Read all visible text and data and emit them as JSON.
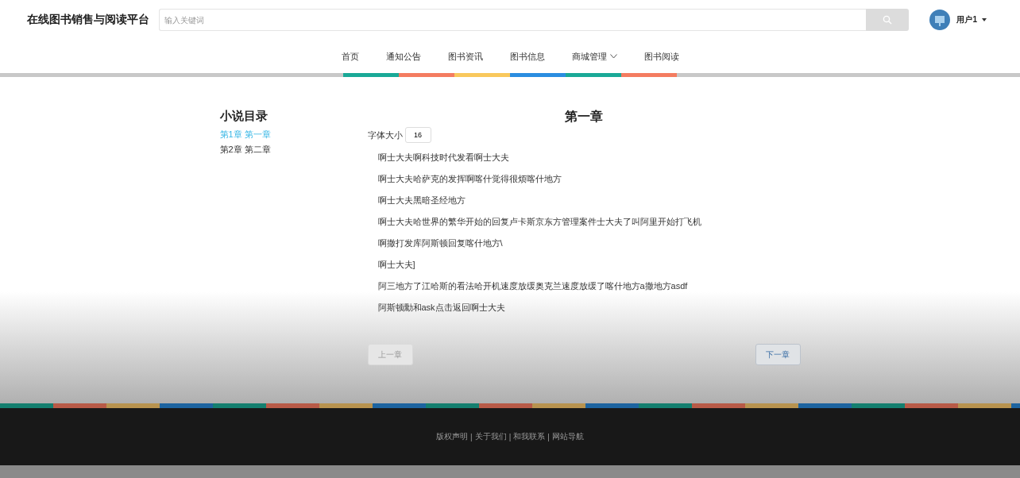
{
  "header": {
    "site_title": "在线图书销售与阅读平台",
    "search": {
      "placeholder": "输入关键词"
    },
    "user": {
      "name": "用户1"
    }
  },
  "nav": [
    {
      "label": "首页",
      "selected": false,
      "dropdown": false
    },
    {
      "label": "通知公告",
      "selected": false,
      "dropdown": false
    },
    {
      "label": "图书资讯",
      "selected": false,
      "dropdown": false
    },
    {
      "label": "图书信息",
      "selected": false,
      "dropdown": false
    },
    {
      "label": "商城管理",
      "selected": false,
      "dropdown": true
    },
    {
      "label": "图书阅读",
      "selected": false,
      "dropdown": false
    }
  ],
  "catalog": {
    "title": "小说目录",
    "chapters": [
      {
        "label": "第1章 第一章",
        "selected": true
      },
      {
        "label": "第2章 第二章",
        "selected": false
      }
    ]
  },
  "reader": {
    "title": "第一章",
    "font_size_label": "字体大小",
    "font_size": "16",
    "paragraphs": [
      "啊士大夫啊科技时代发看啊士大夫",
      "啊士大夫哈萨克的发挥啊喀什觉得很烦喀什地方",
      "啊士大夫黑暗圣经地方",
      "啊士大夫哈世界的繁华开始的回复卢卡斯京东方管理案件士大夫了叫阿里开始打飞机",
      "啊撒打发库阿斯顿回复喀什地方\\",
      "啊士大夫]",
      "阿三地方了江哈斯的看法哈开机速度放缓奥克兰速度放缓了喀什地方a撒地方asdf",
      "阿斯顿勳和ask点击返回啊士大夫"
    ],
    "prev_button": {
      "label": "上一章",
      "disabled": true
    },
    "next_button": {
      "label": "下一章",
      "disabled": false
    }
  },
  "footer": {
    "links": [
      "版权声明",
      "关于我们",
      "和我联系",
      "网站导航"
    ],
    "separator": "|"
  }
}
